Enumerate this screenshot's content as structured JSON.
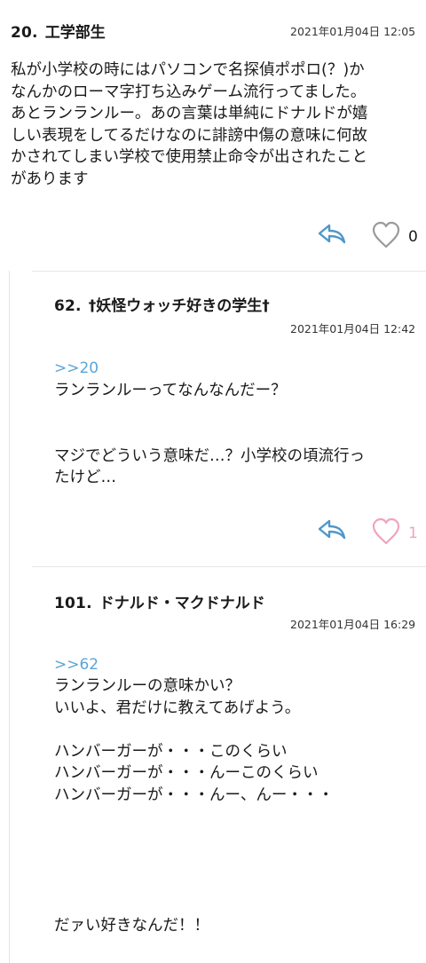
{
  "colors": {
    "reply_icon": "#4e97c9",
    "like_icon_default": "#9a9a9a",
    "like_icon_liked": "#efa3bf",
    "anchor": "#5aa6d6",
    "divider": "#e6e6e6"
  },
  "posts": [
    {
      "number": "20.",
      "name": "工学部生",
      "timestamp": "2021年01月04日 12:05",
      "body": "私が小学校の時にはパソコンで名探偵ポポロ(？)か\nなんかのローマ字打ち込みゲーム流行ってました。\nあとランランルー。あの言葉は単純にドナルドが嬉\nしい表現をしてるだけなのに誹謗中傷の意味に何故\nかされてしまい学校で使用禁止命令が出されたこと\nがあります",
      "like_count": "0",
      "reply_icon": "reply-arrow-icon",
      "like_icon": "heart-outline-icon"
    },
    {
      "number": "62.",
      "name": "†妖怪ウォッチ好きの学生†",
      "timestamp": "2021年01月04日 12:42",
      "anchor": ">>20",
      "body": "ランランルーってなんなんだー？\n\n\nマジでどういう意味だ…？小学校の頃流行っ\nたけど…",
      "like_count": "1",
      "reply_icon": "reply-arrow-icon",
      "like_icon": "heart-outline-icon"
    },
    {
      "number": "101.",
      "name": "ドナルド・マクドナルド",
      "timestamp": "2021年01月04日 16:29",
      "anchor": ">>62",
      "body": "ランランルーの意味かい？\nいいよ、君だけに教えてあげよう。\n\nハンバーガーが・・・このくらい\nハンバーガーが・・・んーこのくらい\nハンバーガーが・・・んー、んー・・・\n\n\n\n\n\nだァい好きなんだ！！"
    }
  ]
}
